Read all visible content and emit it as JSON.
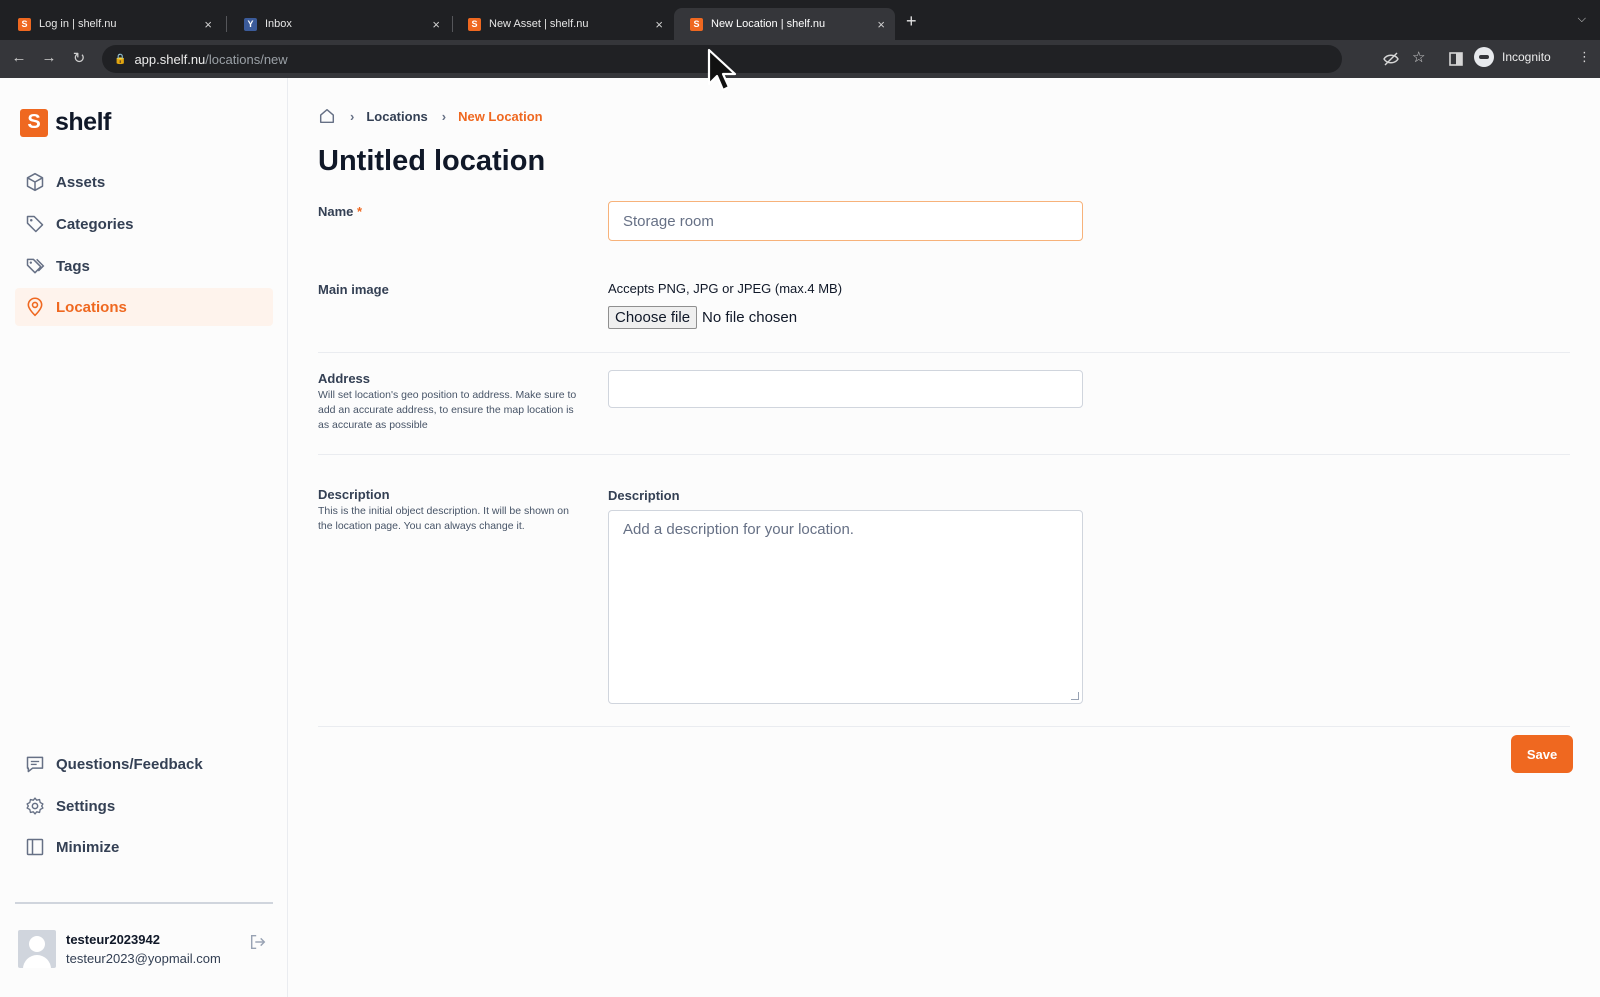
{
  "browser": {
    "tabs": [
      {
        "title": "Log in | shelf.nu",
        "favicon": "S"
      },
      {
        "title": "Inbox",
        "favicon": "Y"
      },
      {
        "title": "New Asset | shelf.nu",
        "favicon": "S"
      },
      {
        "title": "New Location | shelf.nu",
        "favicon": "S",
        "active": true
      }
    ],
    "close_glyph": "×",
    "new_tab_glyph": "+",
    "url_host": "app.shelf.nu",
    "url_path": "/locations/new",
    "profile_label": "Incognito"
  },
  "brand": {
    "logo_letter": "S",
    "name": "shelf",
    "accent": "#ef6820"
  },
  "sidebar": {
    "nav": [
      {
        "label": "Assets",
        "icon": "cube-icon"
      },
      {
        "label": "Categories",
        "icon": "tag-icon"
      },
      {
        "label": "Tags",
        "icon": "tags-icon"
      },
      {
        "label": "Locations",
        "icon": "map-pin-icon",
        "active": true
      }
    ],
    "bottom": [
      {
        "label": "Questions/Feedback",
        "icon": "message-icon"
      },
      {
        "label": "Settings",
        "icon": "gear-icon"
      },
      {
        "label": "Minimize",
        "icon": "sidebar-toggle-icon"
      }
    ],
    "user": {
      "name": "testeur2023942",
      "email": "testeur2023@yopmail.com"
    }
  },
  "breadcrumb": {
    "items": [
      "Locations",
      "New Location"
    ],
    "separator": "›"
  },
  "page": {
    "title": "Untitled location"
  },
  "form": {
    "name": {
      "label": "Name",
      "required_mark": "*",
      "placeholder": "Storage room",
      "value": ""
    },
    "main_image": {
      "label": "Main image",
      "accepts": "Accepts PNG, JPG or JPEG (max.4 MB)",
      "button": "Choose file",
      "status": "No file chosen"
    },
    "address": {
      "label": "Address",
      "help": "Will set location's geo position to address. Make sure to add an accurate address, to ensure the map location is as accurate as possible",
      "value": ""
    },
    "description": {
      "label": "Description",
      "help": "This is the initial object description. It will be shown on the location page. You can always change it.",
      "field_label": "Description",
      "placeholder": "Add a description for your location."
    },
    "save": "Save"
  }
}
